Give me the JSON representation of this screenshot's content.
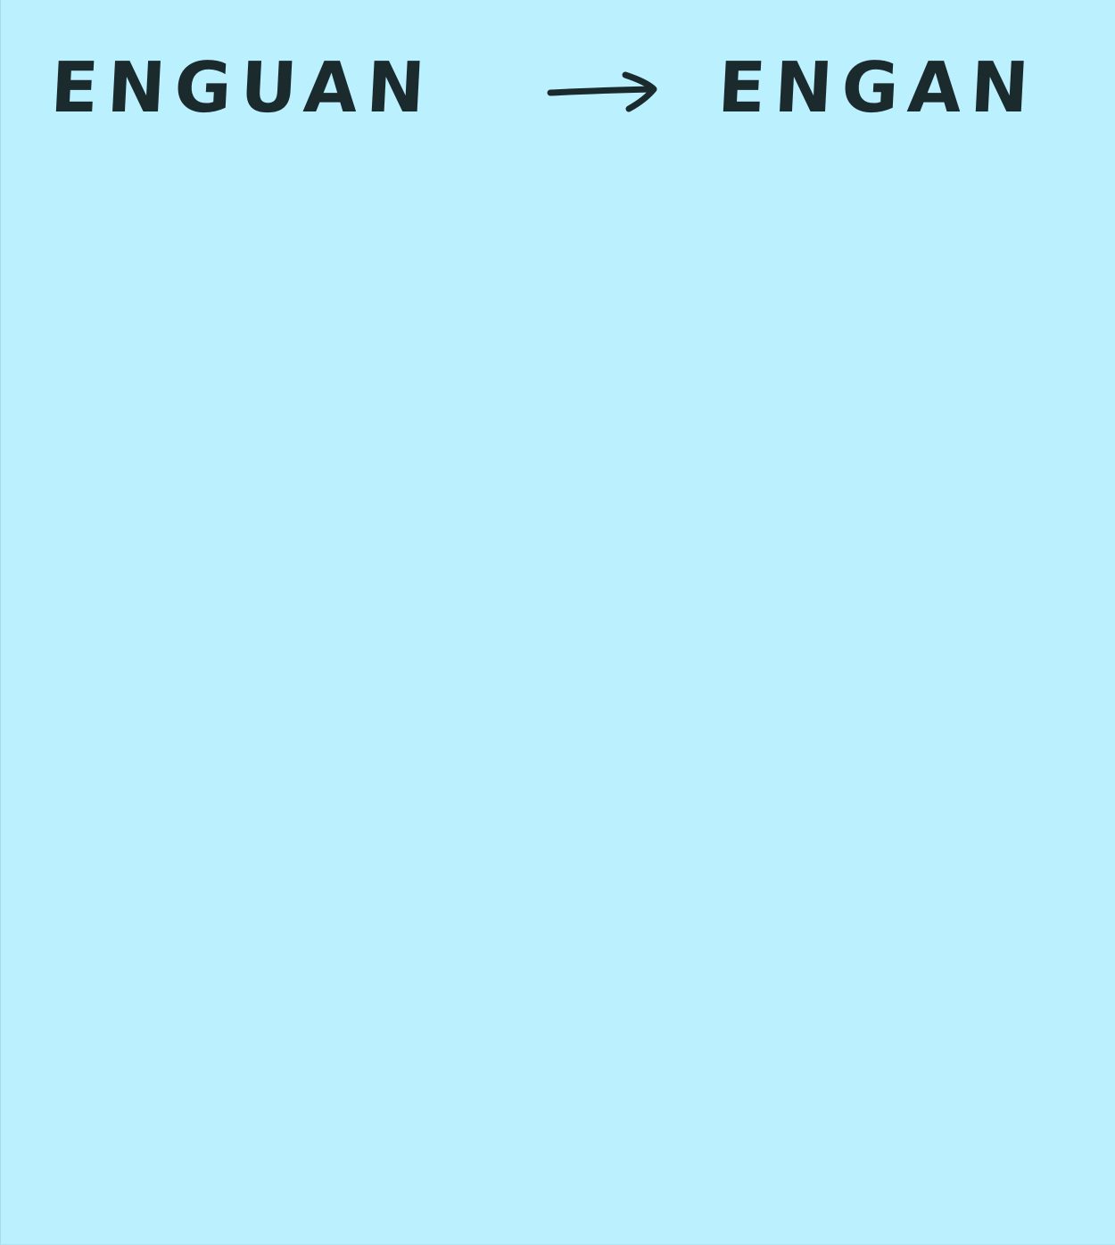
{
  "note": {
    "background_color": "#bbf0ff",
    "ink_color": "#1b2a2c",
    "source_word": "ENGUAN",
    "arrow_icon": "right-arrow-icon",
    "target_word": "ENGAN"
  }
}
